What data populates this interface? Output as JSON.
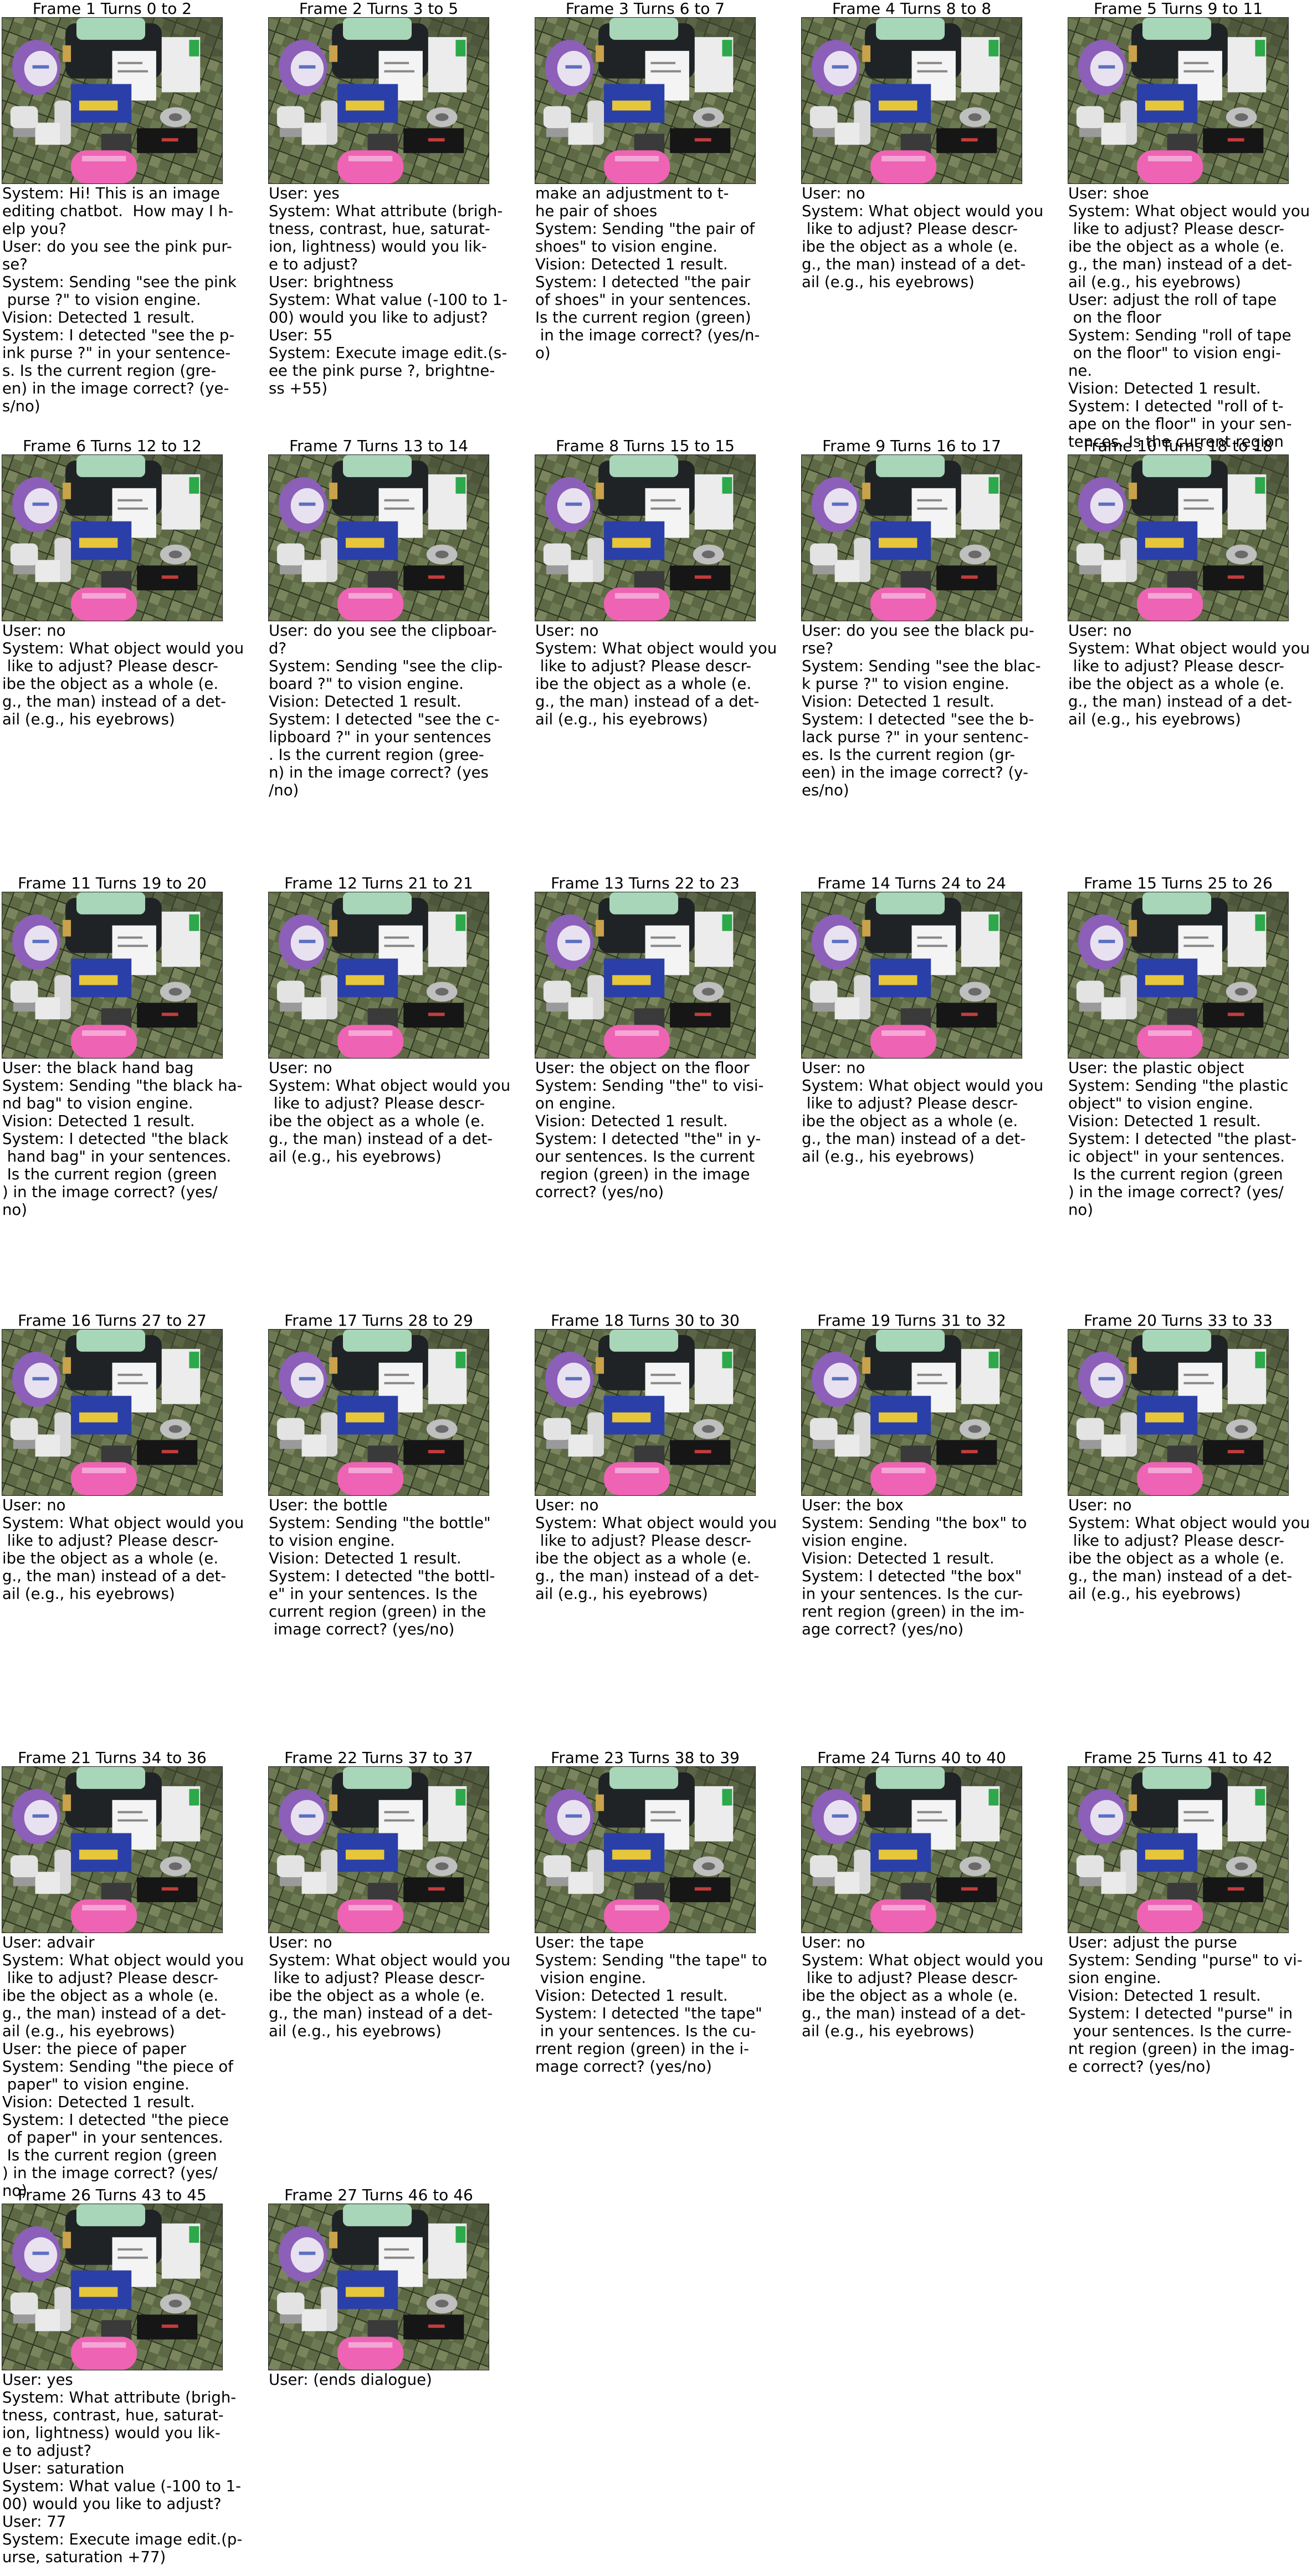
{
  "frames": [
    {
      "title": "Frame 1 Turns 0 to 2",
      "text": "System: Hi! This is an image\nediting chatbot.  How may I h-\nelp you?\nUser: do you see the pink pur-\nse?\nSystem: Sending \"see the pink\n purse ?\" to vision engine.\nVision: Detected 1 result.\nSystem: I detected \"see the p-\nink purse ?\" in your sentence-\ns. Is the current region (gre-\nen) in the image correct? (ye-\ns/no)"
    },
    {
      "title": "Frame 2 Turns 3 to 5",
      "text": "User: yes\nSystem: What attribute (brigh-\ntness, contrast, hue, saturat-\nion, lightness) would you lik-\ne to adjust?\nUser: brightness\nSystem: What value (-100 to 1-\n00) would you like to adjust?\nUser: 55\nSystem: Execute image edit.(s-\nee the pink purse ?, brightne-\nss +55)"
    },
    {
      "title": "Frame 3 Turns 6 to 7",
      "text": "make an adjustment to t-\nhe pair of shoes\nSystem: Sending \"the pair of\nshoes\" to vision engine.\nVision: Detected 1 result.\nSystem: I detected \"the pair\nof shoes\" in your sentences.\nIs the current region (green)\n in the image correct? (yes/n-\no)"
    },
    {
      "title": "Frame 4 Turns 8 to 8",
      "text": "User: no\nSystem: What object would you\n like to adjust? Please descr-\nibe the object as a whole (e.\ng., the man) instead of a det-\nail (e.g., his eyebrows)"
    },
    {
      "title": "Frame 5 Turns 9 to 11",
      "text": "User: shoe\nSystem: What object would you\n like to adjust? Please descr-\nibe the object as a whole (e.\ng., the man) instead of a det-\nail (e.g., his eyebrows)\nUser: adjust the roll of tape\n on the floor\nSystem: Sending \"roll of tape\n on the floor\" to vision engi-\nne.\nVision: Detected 1 result.\nSystem: I detected \"roll of t-\nape on the floor\" in your sen-\ntences. Is the current region"
    },
    {
      "title": "Frame 6 Turns 12 to 12",
      "text": "User: no\nSystem: What object would you\n like to adjust? Please descr-\nibe the object as a whole (e.\ng., the man) instead of a det-\nail (e.g., his eyebrows)"
    },
    {
      "title": "Frame 7 Turns 13 to 14",
      "text": "User: do you see the clipboar-\nd?\nSystem: Sending \"see the clip-\nboard ?\" to vision engine.\nVision: Detected 1 result.\nSystem: I detected \"see the c-\nlipboard ?\" in your sentences\n. Is the current region (gree-\nn) in the image correct? (yes\n/no)"
    },
    {
      "title": "Frame 8 Turns 15 to 15",
      "text": "User: no\nSystem: What object would you\n like to adjust? Please descr-\nibe the object as a whole (e.\ng., the man) instead of a det-\nail (e.g., his eyebrows)"
    },
    {
      "title": "Frame 9 Turns 16 to 17",
      "text": "User: do you see the black pu-\nrse?\nSystem: Sending \"see the blac-\nk purse ?\" to vision engine.\nVision: Detected 1 result.\nSystem: I detected \"see the b-\nlack purse ?\" in your sentenc-\nes. Is the current region (gr-\neen) in the image correct? (y-\nes/no)"
    },
    {
      "title": "Frame 10 Turns 18 to 18",
      "text": "User: no\nSystem: What object would you\n like to adjust? Please descr-\nibe the object as a whole (e.\ng., the man) instead of a det-\nail (e.g., his eyebrows)"
    },
    {
      "title": "Frame 11 Turns 19 to 20",
      "text": "User: the black hand bag\nSystem: Sending \"the black ha-\nnd bag\" to vision engine.\nVision: Detected 1 result.\nSystem: I detected \"the black\n hand bag\" in your sentences.\n Is the current region (green\n) in the image correct? (yes/\nno)"
    },
    {
      "title": "Frame 12 Turns 21 to 21",
      "text": "User: no\nSystem: What object would you\n like to adjust? Please descr-\nibe the object as a whole (e.\ng., the man) instead of a det-\nail (e.g., his eyebrows)"
    },
    {
      "title": "Frame 13 Turns 22 to 23",
      "text": "User: the object on the floor\nSystem: Sending \"the\" to visi-\non engine.\nVision: Detected 1 result.\nSystem: I detected \"the\" in y-\nour sentences. Is the current\n region (green) in the image\ncorrect? (yes/no)"
    },
    {
      "title": "Frame 14 Turns 24 to 24",
      "text": "User: no\nSystem: What object would you\n like to adjust? Please descr-\nibe the object as a whole (e.\ng., the man) instead of a det-\nail (e.g., his eyebrows)"
    },
    {
      "title": "Frame 15 Turns 25 to 26",
      "text": "User: the plastic object\nSystem: Sending \"the plastic\nobject\" to vision engine.\nVision: Detected 1 result.\nSystem: I detected \"the plast-\nic object\" in your sentences.\n Is the current region (green\n) in the image correct? (yes/\nno)"
    },
    {
      "title": "Frame 16 Turns 27 to 27",
      "text": "User: no\nSystem: What object would you\n like to adjust? Please descr-\nibe the object as a whole (e.\ng., the man) instead of a det-\nail (e.g., his eyebrows)"
    },
    {
      "title": "Frame 17 Turns 28 to 29",
      "text": "User: the bottle\nSystem: Sending \"the bottle\"\nto vision engine.\nVision: Detected 1 result.\nSystem: I detected \"the bottl-\ne\" in your sentences. Is the\ncurrent region (green) in the\n image correct? (yes/no)"
    },
    {
      "title": "Frame 18 Turns 30 to 30",
      "text": "User: no\nSystem: What object would you\n like to adjust? Please descr-\nibe the object as a whole (e.\ng., the man) instead of a det-\nail (e.g., his eyebrows)"
    },
    {
      "title": "Frame 19 Turns 31 to 32",
      "text": "User: the box\nSystem: Sending \"the box\" to\nvision engine.\nVision: Detected 1 result.\nSystem: I detected \"the box\"\nin your sentences. Is the cur-\nrent region (green) in the im-\nage correct? (yes/no)"
    },
    {
      "title": "Frame 20 Turns 33 to 33",
      "text": "User: no\nSystem: What object would you\n like to adjust? Please descr-\nibe the object as a whole (e.\ng., the man) instead of a det-\nail (e.g., his eyebrows)"
    },
    {
      "title": "Frame 21 Turns 34 to 36",
      "text": "User: advair\nSystem: What object would you\n like to adjust? Please descr-\nibe the object as a whole (e.\ng., the man) instead of a det-\nail (e.g., his eyebrows)\nUser: the piece of paper\nSystem: Sending \"the piece of\n paper\" to vision engine.\nVision: Detected 1 result.\nSystem: I detected \"the piece\n of paper\" in your sentences.\n Is the current region (green\n) in the image correct? (yes/\nno)"
    },
    {
      "title": "Frame 22 Turns 37 to 37",
      "text": "User: no\nSystem: What object would you\n like to adjust? Please descr-\nibe the object as a whole (e.\ng., the man) instead of a det-\nail (e.g., his eyebrows)"
    },
    {
      "title": "Frame 23 Turns 38 to 39",
      "text": "User: the tape\nSystem: Sending \"the tape\" to\n vision engine.\nVision: Detected 1 result.\nSystem: I detected \"the tape\"\n in your sentences. Is the cu-\nrrent region (green) in the i-\nmage correct? (yes/no)"
    },
    {
      "title": "Frame 24 Turns 40 to 40",
      "text": "User: no\nSystem: What object would you\n like to adjust? Please descr-\nibe the object as a whole (e.\ng., the man) instead of a det-\nail (e.g., his eyebrows)"
    },
    {
      "title": "Frame 25 Turns 41 to 42",
      "text": "User: adjust the purse\nSystem: Sending \"purse\" to vi-\nsion engine.\nVision: Detected 1 result.\nSystem: I detected \"purse\" in\n your sentences. Is the curre-\nnt region (green) in the imag-\ne correct? (yes/no)"
    },
    {
      "title": "Frame 26 Turns 43 to 45",
      "text": "User: yes\nSystem: What attribute (brigh-\ntness, contrast, hue, saturat-\nion, lightness) would you lik-\ne to adjust?\nUser: saturation\nSystem: What value (-100 to 1-\n00) would you like to adjust?\nUser: 77\nSystem: Execute image edit.(p-\nurse, saturation +77)"
    },
    {
      "title": "Frame 27 Turns 46 to 46",
      "text": "User: (ends dialogue)"
    }
  ]
}
